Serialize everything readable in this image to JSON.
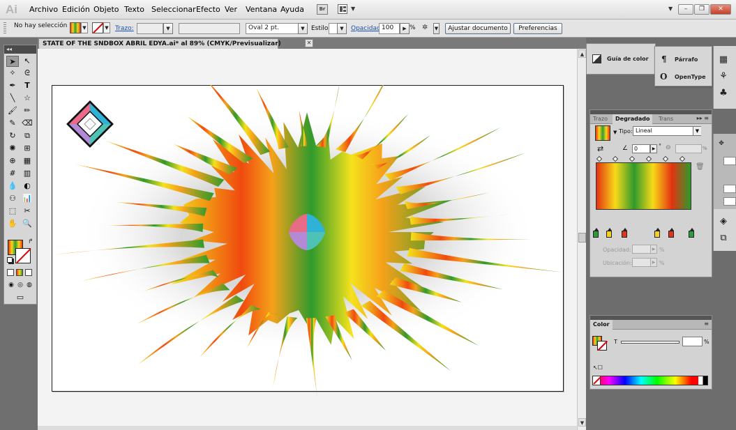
{
  "app": {
    "logo_text": "Ai",
    "menu": [
      "Archivo",
      "Edición",
      "Objeto",
      "Texto",
      "Seleccionar",
      "Efecto",
      "Ver",
      "Ventana",
      "Ayuda"
    ],
    "bridge_label": "Br",
    "window_buttons": {
      "minimize": "–",
      "restore": "❐",
      "close": "✕"
    }
  },
  "control_bar": {
    "selection_status": "No hay selección",
    "stroke_link": "Trazo:",
    "brush_value": "Oval 2 pt.",
    "style_label": "Estilo:",
    "opacity_link": "Opacidad:",
    "opacity_value": "100",
    "opacity_unit": "%",
    "fit_document_button": "Ajustar documento",
    "preferences_button": "Preferencias"
  },
  "document": {
    "tab_title": "STATE OF THE SNDBOX ABRIL EDYA.ai* al 89% (CMYK/Previsualizar)",
    "tab_close": "✕"
  },
  "dock": {
    "guide_label": "Guía de color",
    "paragraph_label": "Párrafo",
    "opentype_label": "OpenType"
  },
  "gradient_panel": {
    "tabs": [
      "Trazo",
      "Degradado",
      "Trans"
    ],
    "active_tab": "Degradado",
    "type_label": "Tipo:",
    "type_value": "Lineal",
    "angle_value": "0",
    "angle_unit": "°",
    "aspect_unit": "%",
    "opacity_label": "Opacidad:",
    "opacity_unit": "%",
    "location_label": "Ubicación:",
    "location_unit": "%",
    "stops": [
      {
        "color": "#2e9b3a",
        "location": 0
      },
      {
        "color": "#f2d21f",
        "location": 0.14
      },
      {
        "color": "#e2341b",
        "location": 0.3
      },
      {
        "color": "#2e9b3a",
        "location": 0.64
      },
      {
        "color": "#f2d21f",
        "location": 0.64
      },
      {
        "color": "#e2341b",
        "location": 0.79
      },
      {
        "color": "#2e9b3a",
        "location": 1
      }
    ],
    "bar_colors": [
      "#e43212",
      "#f8da18",
      "#2f9a2c",
      "#f8da18",
      "#e43212",
      "#2f9a2c"
    ]
  },
  "color_panel": {
    "tab": "Color",
    "tint_label": "T",
    "tint_unit": "%"
  },
  "colors": {
    "burst_red": "#f04a0f",
    "burst_orange": "#f6a21a",
    "burst_yellow": "#f4e21c",
    "burst_green": "#2f9a2c",
    "logo_pink": "#e86b88",
    "logo_cyan": "#2fb2d6",
    "logo_purple": "#b48ad6",
    "logo_teal": "#4ec2b4"
  }
}
